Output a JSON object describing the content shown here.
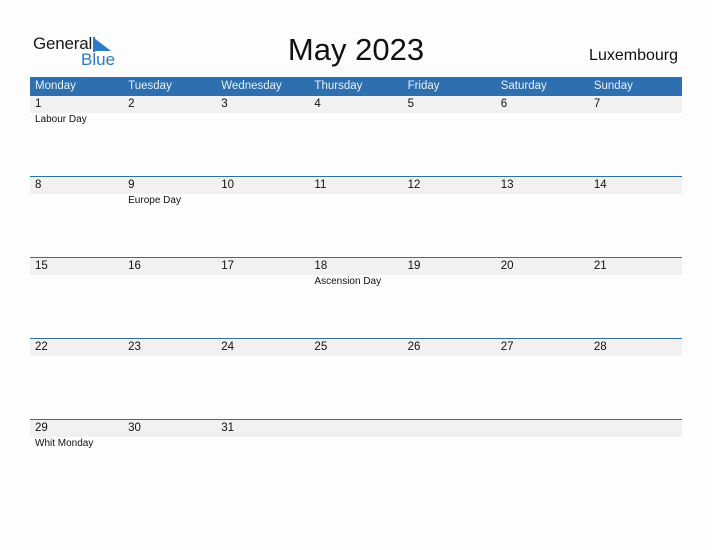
{
  "logo": {
    "word1": "General",
    "word2": "Blue"
  },
  "title": "May 2023",
  "country": "Luxembourg",
  "weekdays": [
    "Monday",
    "Tuesday",
    "Wednesday",
    "Thursday",
    "Friday",
    "Saturday",
    "Sunday"
  ],
  "weeks": [
    {
      "days": [
        "1",
        "2",
        "3",
        "4",
        "5",
        "6",
        "7"
      ],
      "events": [
        "Labour Day",
        "",
        "",
        "",
        "",
        "",
        ""
      ]
    },
    {
      "days": [
        "8",
        "9",
        "10",
        "11",
        "12",
        "13",
        "14"
      ],
      "events": [
        "",
        "Europe Day",
        "",
        "",
        "",
        "",
        ""
      ]
    },
    {
      "days": [
        "15",
        "16",
        "17",
        "18",
        "19",
        "20",
        "21"
      ],
      "events": [
        "",
        "",
        "",
        "Ascension Day",
        "",
        "",
        ""
      ]
    },
    {
      "days": [
        "22",
        "23",
        "24",
        "25",
        "26",
        "27",
        "28"
      ],
      "events": [
        "",
        "",
        "",
        "",
        "",
        "",
        ""
      ]
    },
    {
      "days": [
        "29",
        "30",
        "31",
        "",
        "",
        "",
        ""
      ],
      "events": [
        "Whit Monday",
        "",
        "",
        "",
        "",
        "",
        ""
      ]
    }
  ],
  "colors": {
    "header": "#2e6fb0",
    "date_band": "#f1f1f1",
    "brand_blue": "#2a7bc8"
  }
}
